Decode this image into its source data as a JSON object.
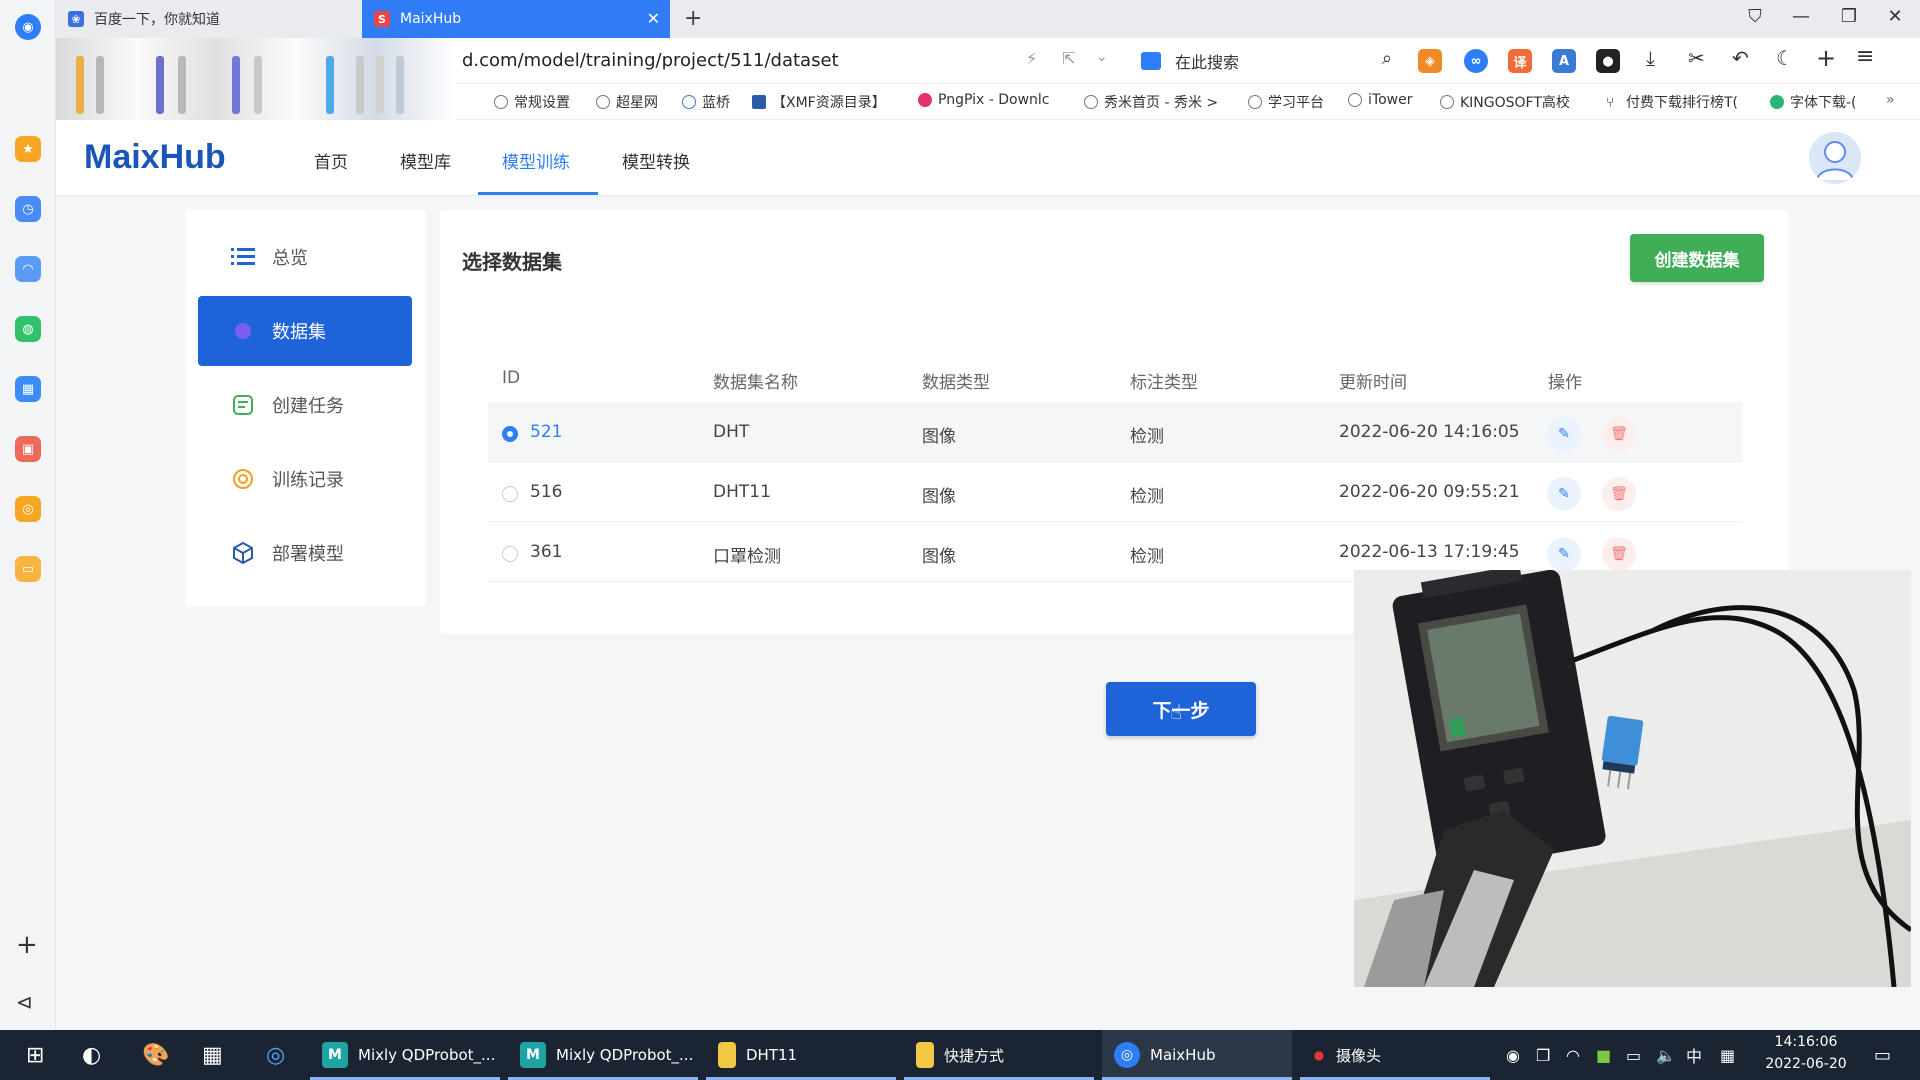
{
  "browser": {
    "tabs": [
      {
        "label": "百度一下，你就知道",
        "icon": "baidu-paw-icon"
      },
      {
        "label": "MaixHub",
        "icon": "maixhub-s-icon",
        "active": true
      }
    ],
    "new_tab_symbol": "+",
    "address": "d.com/model/training/project/511/dataset",
    "search_placeholder": "在此搜索",
    "bookmarks": [
      "常规设置",
      "超星网",
      "蓝桥",
      "【XMF资源目录】",
      "PngPix - Downlc",
      "秀米首页 - 秀米 >",
      "学习平台",
      "iTower",
      "KINGOSOFT高校",
      "付费下载排行榜T(",
      "字体下载-("
    ]
  },
  "header": {
    "logo": "MaixHub",
    "nav": [
      "首页",
      "模型库",
      "模型训练",
      "模型转换"
    ],
    "active_nav": "模型训练"
  },
  "menu": {
    "items": [
      "总览",
      "数据集",
      "创建任务",
      "训练记录",
      "部署模型"
    ],
    "active": "数据集"
  },
  "panel": {
    "title": "选择数据集",
    "create_button": "创建数据集",
    "columns": [
      "ID",
      "数据集名称",
      "数据类型",
      "标注类型",
      "更新时间",
      "操作"
    ],
    "rows": [
      {
        "id": "521",
        "name": "DHT",
        "data_type": "图像",
        "label_type": "检测",
        "updated": "2022-06-20 14:16:05",
        "selected": true
      },
      {
        "id": "516",
        "name": "DHT11",
        "data_type": "图像",
        "label_type": "检测",
        "updated": "2022-06-20 09:55:21",
        "selected": false
      },
      {
        "id": "361",
        "name": "口罩检测",
        "data_type": "图像",
        "label_type": "检测",
        "updated": "2022-06-13 17:19:45",
        "selected": false
      }
    ]
  },
  "next_button": "下一步",
  "taskbar": {
    "apps": [
      {
        "label": "Mixly QDProbot_...",
        "icon": "mixly-icon"
      },
      {
        "label": "Mixly QDProbot_...",
        "icon": "mixly-icon"
      },
      {
        "label": "DHT11",
        "icon": "folder-icon"
      },
      {
        "label": "快捷方式",
        "icon": "folder-icon"
      },
      {
        "label": "MaixHub",
        "icon": "browser-icon"
      },
      {
        "label": "摄像头",
        "icon": "record-dot-icon"
      }
    ],
    "ime": "中",
    "time": "14:16:06",
    "date": "2022-06-20"
  },
  "colors": {
    "primary": "#1f63d8",
    "accent": "#2d7ef7",
    "create_green": "#3fae57",
    "taskbar": "#1b2432"
  }
}
